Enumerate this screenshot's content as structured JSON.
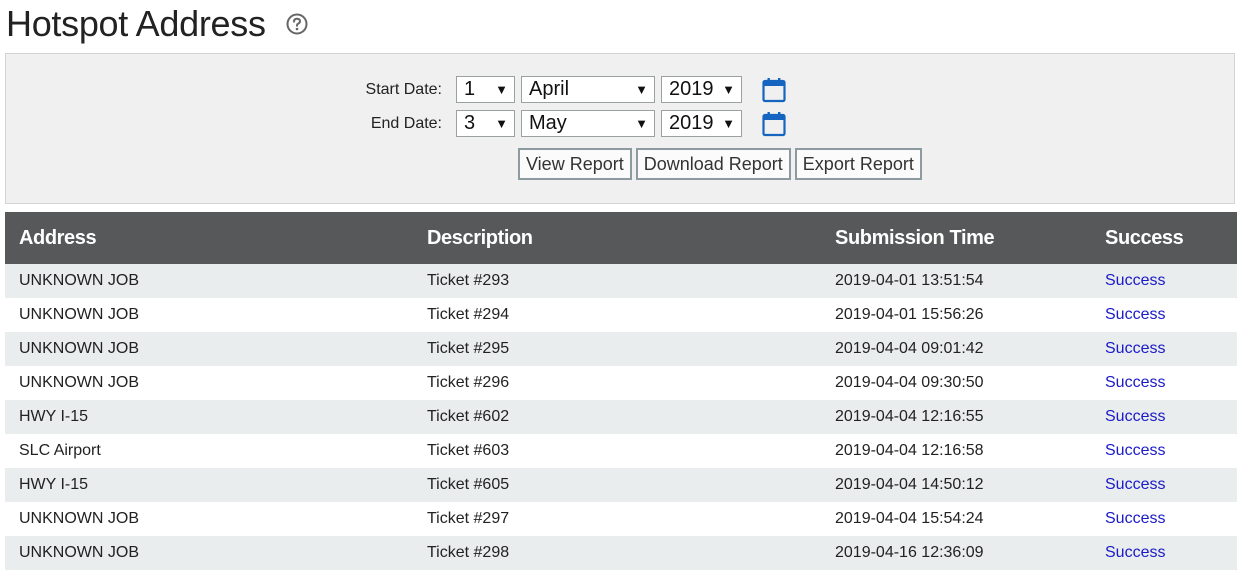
{
  "page": {
    "title": "Hotspot Address",
    "help_icon": "help-circle-icon"
  },
  "filters": {
    "start": {
      "label": "Start Date:",
      "day": "1",
      "month": "April",
      "year": "2019"
    },
    "end": {
      "label": "End Date:",
      "day": "3",
      "month": "May",
      "year": "2019"
    },
    "calendar_icon": "calendar-icon",
    "buttons": {
      "view": "View Report",
      "download": "Download Report",
      "export": "Export Report"
    }
  },
  "table": {
    "columns": [
      "Address",
      "Description",
      "Submission Time",
      "Success"
    ],
    "rows": [
      {
        "address": "UNKNOWN JOB",
        "description": "Ticket #293",
        "time": "2019-04-01 13:51:54",
        "success": "Success"
      },
      {
        "address": "UNKNOWN JOB",
        "description": "Ticket #294",
        "time": "2019-04-01 15:56:26",
        "success": "Success"
      },
      {
        "address": "UNKNOWN JOB",
        "description": "Ticket #295",
        "time": "2019-04-04 09:01:42",
        "success": "Success"
      },
      {
        "address": "UNKNOWN JOB",
        "description": "Ticket #296",
        "time": "2019-04-04 09:30:50",
        "success": "Success"
      },
      {
        "address": "HWY I-15",
        "description": "Ticket #602",
        "time": "2019-04-04 12:16:55",
        "success": "Success"
      },
      {
        "address": "SLC Airport",
        "description": "Ticket #603",
        "time": "2019-04-04 12:16:58",
        "success": "Success"
      },
      {
        "address": "HWY I-15",
        "description": "Ticket #605",
        "time": "2019-04-04 14:50:12",
        "success": "Success"
      },
      {
        "address": "UNKNOWN JOB",
        "description": "Ticket #297",
        "time": "2019-04-04 15:54:24",
        "success": "Success"
      },
      {
        "address": "UNKNOWN JOB",
        "description": "Ticket #298",
        "time": "2019-04-16 12:36:09",
        "success": "Success"
      }
    ]
  },
  "colors": {
    "header_bg": "#575859",
    "row_alt": "#e9eded",
    "panel_bg": "#eff0ef",
    "link": "#1a1ac8",
    "icon_blue": "#1565c0"
  }
}
